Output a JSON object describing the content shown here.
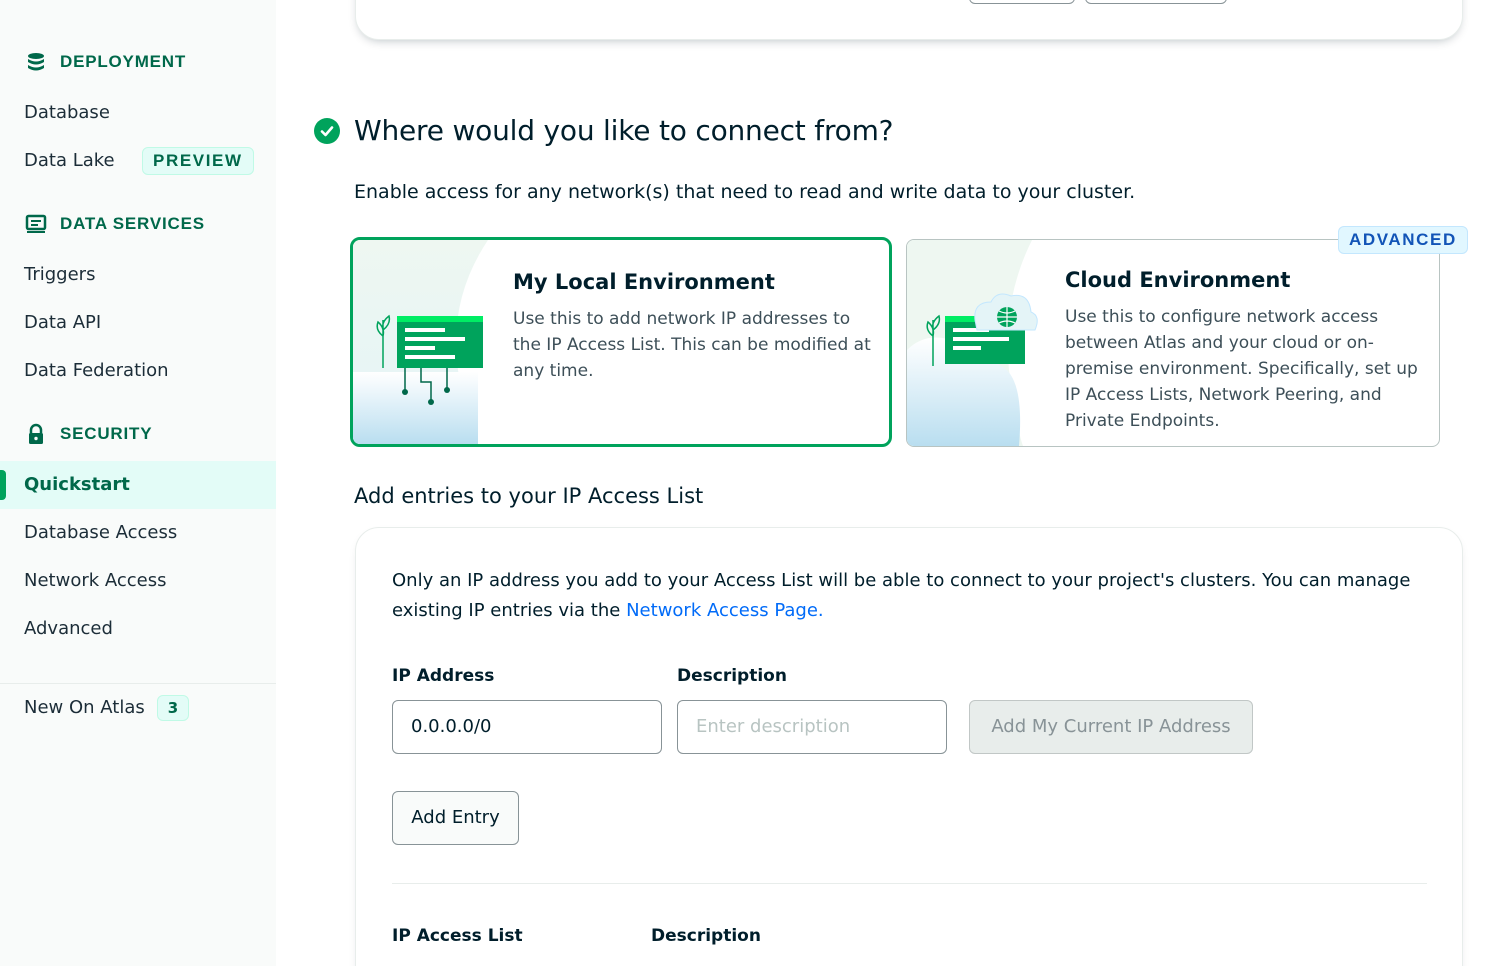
{
  "sidebar": {
    "deployment": {
      "title": "DEPLOYMENT",
      "icon": "database-icon",
      "items": [
        "Database",
        "Data Lake"
      ],
      "preview_badge": "PREVIEW"
    },
    "data_services": {
      "title": "DATA SERVICES",
      "icon": "data-services-icon",
      "items": [
        "Triggers",
        "Data API",
        "Data Federation"
      ]
    },
    "security": {
      "title": "SECURITY",
      "icon": "lock-icon",
      "active": "Quickstart",
      "items": [
        "Database Access",
        "Network Access",
        "Advanced"
      ]
    },
    "new_on_atlas": {
      "label": "New On Atlas",
      "count": "3"
    }
  },
  "main": {
    "title": "Where would you like to connect from?",
    "subtitle": "Enable access for any network(s) that need to read and write data to your cluster.",
    "local_env": {
      "title": "My Local Environment",
      "description": "Use this to add network IP addresses to the IP Access List. This can be modified at any time."
    },
    "cloud_env": {
      "title": "Cloud Environment",
      "description": "Use this to configure network access between Atlas and your cloud or on-premise environment. Specifically, set up IP Access Lists, Network Peering, and Private Endpoints.",
      "badge": "ADVANCED"
    },
    "ip_section_title": "Add entries to your IP Access List",
    "ip_card": {
      "text": "Only an IP address you add to your Access List will be able to connect to your project's clusters. You can manage existing IP entries via the",
      "link": "Network Access Page.",
      "ip_label": "IP Address",
      "ip_value": "0.0.0.0/0",
      "desc_label": "Description",
      "desc_placeholder": "Enter description",
      "add_current_ip": "Add My Current IP Address",
      "add_entry": "Add Entry",
      "list_header_ip": "IP Access List",
      "list_header_desc": "Description"
    }
  },
  "colors": {
    "accent": "#00a35c",
    "brand_dark": "#00684a",
    "link": "#016bf8",
    "advanced": "#1254b7"
  }
}
